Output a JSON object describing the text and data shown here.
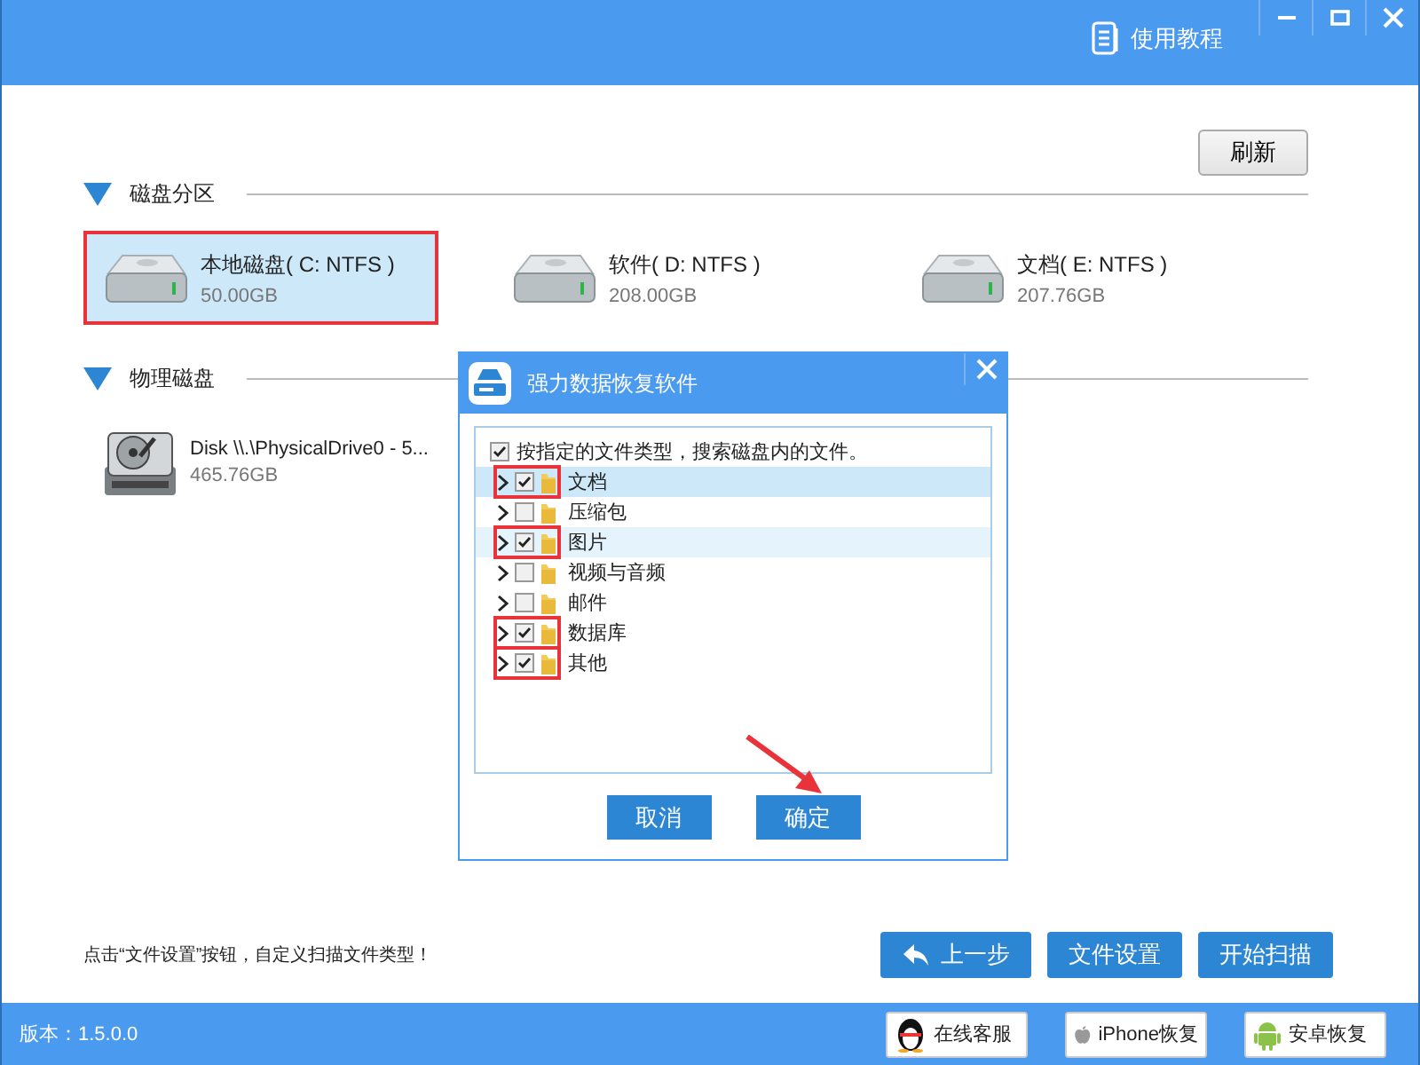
{
  "window": {
    "help_link": "使用教程"
  },
  "refresh_button": "刷新",
  "sections": [
    {
      "title": "磁盘分区",
      "kind": "partition",
      "drives": [
        {
          "name": "本地磁盘( C: NTFS )",
          "size": "50.00GB",
          "selected": true,
          "highlighted": true
        },
        {
          "name": "软件( D: NTFS )",
          "size": "208.00GB",
          "selected": false,
          "highlighted": false
        },
        {
          "name": "文档( E: NTFS )",
          "size": "207.76GB",
          "selected": false,
          "highlighted": false
        }
      ]
    },
    {
      "title": "物理磁盘",
      "kind": "physical",
      "drives": [
        {
          "name": "Disk \\\\.\\PhysicalDrive0 - 5...",
          "size": "465.76GB",
          "selected": false,
          "highlighted": false
        }
      ]
    }
  ],
  "hint": "点击“文件设置”按钮，自定义扫描文件类型！",
  "nav_buttons": [
    {
      "label": "上一步",
      "kind": "back"
    },
    {
      "label": "文件设置",
      "kind": "plain"
    },
    {
      "label": "开始扫描",
      "kind": "plain"
    }
  ],
  "status_bar": {
    "version": "版本：1.5.0.0",
    "buttons": [
      {
        "label": "在线客服",
        "kind": "support"
      },
      {
        "label": "iPhone恢复",
        "kind": "apple"
      },
      {
        "label": "安卓恢复",
        "kind": "android"
      }
    ]
  },
  "dialog": {
    "title": "强力数据恢复软件",
    "root": {
      "label": "按指定的文件类型，搜索磁盘内的文件。",
      "checked": true
    },
    "items": [
      {
        "label": "文档",
        "checked": true,
        "selected": true,
        "hovered": false,
        "highlighted": true
      },
      {
        "label": "压缩包",
        "checked": false,
        "selected": false,
        "hovered": false,
        "highlighted": false
      },
      {
        "label": "图片",
        "checked": true,
        "selected": false,
        "hovered": true,
        "highlighted": true
      },
      {
        "label": "视频与音频",
        "checked": false,
        "selected": false,
        "hovered": false,
        "highlighted": false
      },
      {
        "label": "邮件",
        "checked": false,
        "selected": false,
        "hovered": false,
        "highlighted": false
      },
      {
        "label": "数据库",
        "checked": true,
        "selected": false,
        "hovered": false,
        "highlighted": true
      },
      {
        "label": "其他",
        "checked": true,
        "selected": false,
        "hovered": false,
        "highlighted": true
      }
    ],
    "buttons": [
      {
        "label": "取消",
        "pointed": false
      },
      {
        "label": "确定",
        "pointed": true
      }
    ]
  }
}
